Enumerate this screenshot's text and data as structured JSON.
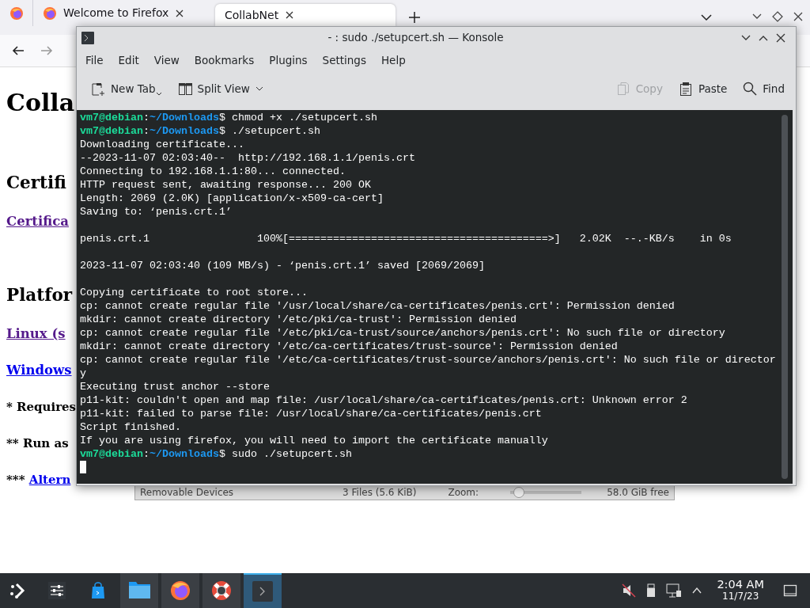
{
  "browser": {
    "tabs": [
      {
        "kind": "pinned",
        "selected": false
      },
      {
        "kind": "page",
        "label": "Welcome to Firefox",
        "selected": false
      },
      {
        "kind": "page",
        "label": "CollabNet",
        "selected": true
      }
    ],
    "page": [
      {
        "kind": "h1",
        "text": "Colla"
      },
      {
        "kind": "h2",
        "text": "Certifi"
      },
      {
        "kind": "link",
        "text": "Certifica",
        "visited": true
      },
      {
        "kind": "h2",
        "text": "Platfor"
      },
      {
        "kind": "link",
        "text": "Linux (s",
        "visited": true
      },
      {
        "kind": "link",
        "text": "Windows",
        "visited": false
      },
      {
        "kind": "note",
        "text": "* Requires"
      },
      {
        "kind": "note",
        "text": "** Run as"
      },
      {
        "kind": "note_link",
        "text": "***",
        "link": "Altern",
        "visited": false
      }
    ]
  },
  "file_manager_status": {
    "location": "Removable Devices",
    "count": "3 Files (5.6 KiB)",
    "zoom_label": "Zoom:",
    "zoom": {
      "level": 0.05
    },
    "free": "58.0 GiB free"
  },
  "konsole": {
    "title": "- : sudo ./setupcert.sh — Konsole",
    "menu": [
      "File",
      "Edit",
      "View",
      "Bookmarks",
      "Plugins",
      "Settings",
      "Help"
    ],
    "toolbar_left": [
      {
        "kind": "new_tab",
        "label": "New Tab",
        "disabled": false
      },
      {
        "kind": "split_view",
        "label": "Split View",
        "disabled": false
      }
    ],
    "toolbar_right": [
      {
        "kind": "copy",
        "label": "Copy",
        "disabled": true
      },
      {
        "kind": "paste",
        "label": "Paste",
        "disabled": false
      },
      {
        "kind": "find",
        "label": "Find",
        "disabled": false
      }
    ],
    "lines": [
      {
        "kind": "prompt",
        "user": "vm7@debian",
        "separator": ":",
        "path": "~/Downloads",
        "command": "$ chmod +x ./setupcert.sh"
      },
      {
        "kind": "prompt",
        "user": "vm7@debian",
        "separator": ":",
        "path": "~/Downloads",
        "command": "$ ./setupcert.sh"
      },
      {
        "kind": "output",
        "text": "Downloading certificate..."
      },
      {
        "kind": "output",
        "text": "--2023-11-07 02:03:40--  http://192.168.1.1/penis.crt"
      },
      {
        "kind": "output",
        "text": "Connecting to 192.168.1.1:80... connected."
      },
      {
        "kind": "output",
        "text": "HTTP request sent, awaiting response... 200 OK"
      },
      {
        "kind": "output",
        "text": "Length: 2069 (2.0K) [application/x-x509-ca-cert]"
      },
      {
        "kind": "output",
        "text": "Saving to: ‘penis.crt.1’"
      },
      {
        "kind": "blank"
      },
      {
        "kind": "output",
        "text": "penis.crt.1                 100%[=========================================>]   2.02K  --.-KB/s    in 0s"
      },
      {
        "kind": "blank"
      },
      {
        "kind": "output",
        "text": "2023-11-07 02:03:40 (109 MB/s) - ‘penis.crt.1’ saved [2069/2069]"
      },
      {
        "kind": "blank"
      },
      {
        "kind": "output",
        "text": "Copying certificate to root store..."
      },
      {
        "kind": "output",
        "text": "cp: cannot create regular file '/usr/local/share/ca-certificates/penis.crt': Permission denied"
      },
      {
        "kind": "output",
        "text": "mkdir: cannot create directory '/etc/pki/ca-trust': Permission denied"
      },
      {
        "kind": "output",
        "text": "cp: cannot create regular file '/etc/pki/ca-trust/source/anchors/penis.crt': No such file or directory"
      },
      {
        "kind": "output",
        "text": "mkdir: cannot create directory '/etc/ca-certificates/trust-source': Permission denied"
      },
      {
        "kind": "output",
        "text": "cp: cannot create regular file '/etc/ca-certificates/trust-source/anchors/penis.crt': No such file or director"
      },
      {
        "kind": "output",
        "text": "y"
      },
      {
        "kind": "output",
        "text": "Executing trust anchor --store"
      },
      {
        "kind": "output",
        "text": "p11-kit: couldn't open and map file: /usr/local/share/ca-certificates/penis.crt: Unknown error 2"
      },
      {
        "kind": "output",
        "text": "p11-kit: failed to parse file: /usr/local/share/ca-certificates/penis.crt"
      },
      {
        "kind": "output",
        "text": "Script finished."
      },
      {
        "kind": "output",
        "text": "If you are using firefox, you will need to import the certificate manually"
      },
      {
        "kind": "prompt",
        "user": "vm7@debian",
        "separator": ":",
        "path": "~/Downloads",
        "command": "$ sudo ./setupcert.sh"
      },
      {
        "kind": "cursor"
      }
    ]
  },
  "taskbar": {
    "apps": [
      {
        "kind": "launcher",
        "open": false,
        "selected": false
      },
      {
        "kind": "settings",
        "open": false,
        "selected": false
      },
      {
        "kind": "store",
        "open": false,
        "selected": false
      },
      {
        "kind": "files",
        "open": true,
        "selected": false
      },
      {
        "kind": "firefox",
        "open": true,
        "selected": false
      },
      {
        "kind": "help",
        "open": true,
        "selected": false
      },
      {
        "kind": "terminal",
        "open": true,
        "selected": true
      }
    ],
    "time": "2:04 AM",
    "date": "11/7/23"
  }
}
